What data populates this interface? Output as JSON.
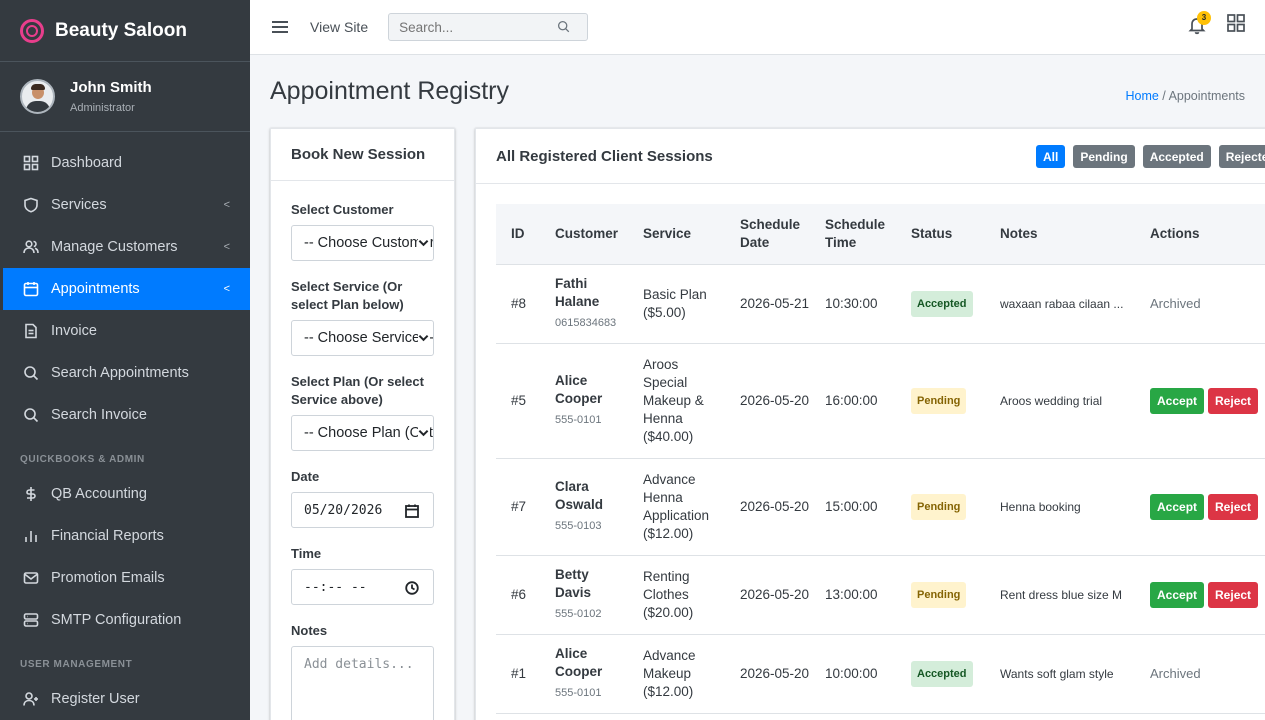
{
  "brand": {
    "name": "Beauty Saloon"
  },
  "user": {
    "name": "John Smith",
    "role": "Administrator"
  },
  "sidebar": {
    "items": [
      {
        "label": "Dashboard",
        "icon": "dashboard-icon"
      },
      {
        "label": "Services",
        "icon": "shield-icon",
        "caret": "<"
      },
      {
        "label": "Manage Customers",
        "icon": "users-icon",
        "caret": "<"
      },
      {
        "label": "Appointments",
        "icon": "calendar-icon",
        "caret": "<",
        "active": true
      },
      {
        "label": "Invoice",
        "icon": "document-icon"
      },
      {
        "label": "Search Appointments",
        "icon": "search-icon"
      },
      {
        "label": "Search Invoice",
        "icon": "search-icon"
      }
    ],
    "section_quickbooks": "QUICKBOOKS & ADMIN",
    "qb_items": [
      {
        "label": "QB Accounting",
        "icon": "dollar-icon"
      },
      {
        "label": "Financial Reports",
        "icon": "bar-chart-icon"
      },
      {
        "label": "Promotion Emails",
        "icon": "mail-icon"
      },
      {
        "label": "SMTP Configuration",
        "icon": "server-icon"
      }
    ],
    "section_users": "USER MANAGEMENT",
    "user_items": [
      {
        "label": "Register User",
        "icon": "user-plus-icon"
      }
    ]
  },
  "topbar": {
    "view_site": "View Site",
    "search_placeholder": "Search...",
    "notification_count": "3"
  },
  "page": {
    "title": "Appointment Registry",
    "breadcrumb_home": "Home",
    "breadcrumb_sep": " / ",
    "breadcrumb_current": "Appointments"
  },
  "form": {
    "title": "Book New Session",
    "customer_label": "Select Customer",
    "customer_value": "-- Choose Customer --",
    "service_label": "Select Service (Or select Plan below)",
    "service_value": "-- Choose Service --",
    "plan_label": "Select Plan (Or select Service above)",
    "plan_value": "-- Choose Plan (Optional) --",
    "date_label": "Date",
    "date_value": "05/20/2026",
    "time_label": "Time",
    "time_value": "--:-- --",
    "notes_label": "Notes",
    "notes_placeholder": "Add details..."
  },
  "list": {
    "title": "All Registered Client Sessions",
    "filters": [
      "All",
      "Pending",
      "Accepted",
      "Rejected"
    ],
    "columns": [
      "ID",
      "Customer",
      "Service",
      "Schedule Date",
      "Schedule Time",
      "Status",
      "Notes",
      "Actions"
    ],
    "rows": [
      {
        "id": "#8",
        "customer": "Fathi Halane",
        "phone": "0615834683",
        "service": "Basic Plan ($5.00)",
        "date": "2026-05-21",
        "time": "10:30:00",
        "status": "Accepted",
        "notes": "waxaan rabaa cilaan ...",
        "action": "Archived"
      },
      {
        "id": "#5",
        "customer": "Alice Cooper",
        "phone": "555-0101",
        "service": "Aroos Special Makeup & Henna ($40.00)",
        "date": "2026-05-20",
        "time": "16:00:00",
        "status": "Pending",
        "notes": "Aroos wedding trial",
        "accept": "Accept",
        "reject": "Reject"
      },
      {
        "id": "#7",
        "customer": "Clara Oswald",
        "phone": "555-0103",
        "service": "Advance Henna Application ($12.00)",
        "date": "2026-05-20",
        "time": "15:00:00",
        "status": "Pending",
        "notes": "Henna booking",
        "accept": "Accept",
        "reject": "Reject"
      },
      {
        "id": "#6",
        "customer": "Betty Davis",
        "phone": "555-0102",
        "service": "Renting Clothes ($20.00)",
        "date": "2026-05-20",
        "time": "13:00:00",
        "status": "Pending",
        "notes": "Rent dress blue size M",
        "accept": "Accept",
        "reject": "Reject"
      },
      {
        "id": "#1",
        "customer": "Alice Cooper",
        "phone": "555-0101",
        "service": "Advance Makeup ($12.00)",
        "date": "2026-05-20",
        "time": "10:00:00",
        "status": "Accepted",
        "notes": "Wants soft glam style",
        "action": "Archived"
      }
    ]
  },
  "colors": {
    "sidebar_bg": "#343a40",
    "primary": "#007bff",
    "brand_accent": "#e83e8c",
    "success": "#28a745",
    "danger": "#dc3545",
    "warning": "#ffc107"
  }
}
